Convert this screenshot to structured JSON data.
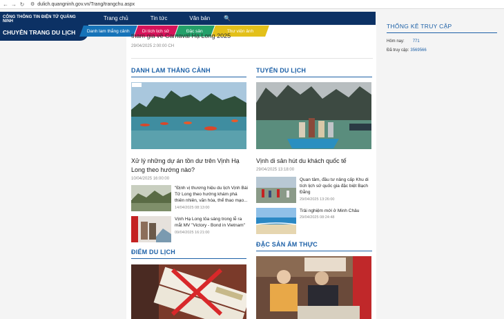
{
  "browser": {
    "url": "dulich.quangninh.gov.vn/Trang/trangchu.aspx"
  },
  "header": {
    "portal": "CỔNG THÔNG TIN ĐIỆN TỬ QUẢNG NINH",
    "site": "CHUYÊN TRANG DU LỊCH",
    "nav": [
      "Trang chủ",
      "Tin tức",
      "Văn bản"
    ],
    "subnav": [
      "Danh lam thắng cảnh",
      "Di tích lịch sử",
      "Đặc sản",
      "Thư viện ảnh"
    ]
  },
  "lead": {
    "title": "tham gia về Carnaval Hạ Long 2025",
    "date": "29/04/2025 2:00:00 CH"
  },
  "sections": {
    "danh_lam": {
      "title": "DANH LAM THẮNG CẢNH",
      "main_title": "Xử lý những dự án tồn dư trên Vịnh Hạ Long theo hướng nào?",
      "main_date": "10/04/2025 16:00:00",
      "items": [
        {
          "title": "\"Định vị thương hiệu du lịch Vịnh Bái Tử Long theo hướng khám phá thiên nhiên, văn hóa, thể thao mạo...",
          "date": "14/04/2025 08:13:00"
        },
        {
          "title": "Vịnh Hạ Long tỏa sáng trong lễ ra mắt MV \"Victory - Bond in Vietnam\"",
          "date": "09/04/2025 16:21:00"
        }
      ]
    },
    "tuyen": {
      "title": "TUYẾN DU LỊCH",
      "main_title": "Vịnh di sản hút du khách quốc tế",
      "main_date": "29/04/2025 13:18:00",
      "items": [
        {
          "title": "Quan tâm, đầu tư nâng cấp Khu di tích lịch sử quốc gia đặc biệt Bạch Đằng",
          "date": "29/04/2025 13:26:00"
        },
        {
          "title": "Trải nghiệm mới ở Minh Châu",
          "date": "29/04/2025 08:24:48"
        }
      ]
    },
    "diem": {
      "title": "ĐIỂM DU LỊCH"
    },
    "dac_san": {
      "title": "ĐẶC SẢN ẨM THỰC"
    }
  },
  "stats": {
    "title": "THỐNG KÊ TRUY CẬP",
    "today_label": "Hôm nay:",
    "today_value": "771",
    "total_label": "Đã truy cập:",
    "total_value": "3569566"
  }
}
